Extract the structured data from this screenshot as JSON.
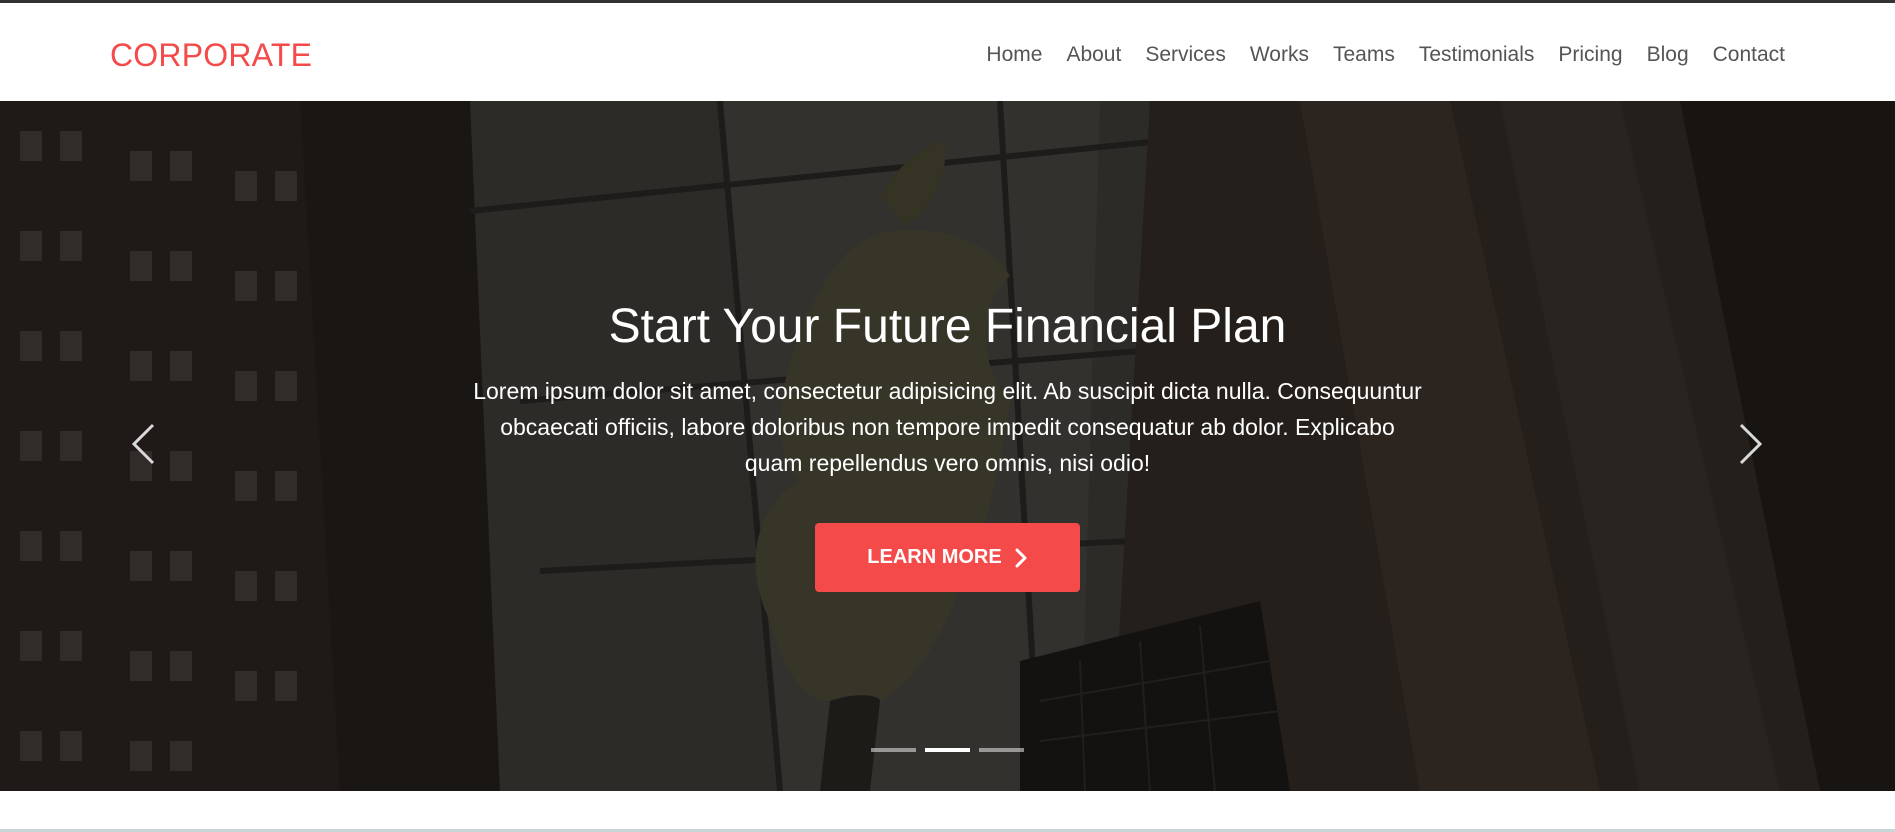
{
  "brand": {
    "logo_text": "CORPORATE",
    "accent_color": "#f44a4a"
  },
  "nav": {
    "items": [
      {
        "label": "Home"
      },
      {
        "label": "About"
      },
      {
        "label": "Services"
      },
      {
        "label": "Works"
      },
      {
        "label": "Teams"
      },
      {
        "label": "Testimonials"
      },
      {
        "label": "Pricing"
      },
      {
        "label": "Blog"
      },
      {
        "label": "Contact"
      }
    ]
  },
  "hero": {
    "title": "Start Your Future Financial Plan",
    "text": "Lorem ipsum dolor sit amet, consectetur adipisicing elit. Ab suscipit dicta nulla. Consequuntur obcaecati officiis, labore doloribus non tempore impedit consequatur ab dolor. Explicabo quam repellendus vero omnis, nisi odio!",
    "cta_label": "LEARN MORE",
    "cta_icon": "chevron-right-icon",
    "prev_icon": "chevron-left-icon",
    "next_icon": "chevron-right-icon",
    "slide_count": 3,
    "active_slide": 2
  }
}
